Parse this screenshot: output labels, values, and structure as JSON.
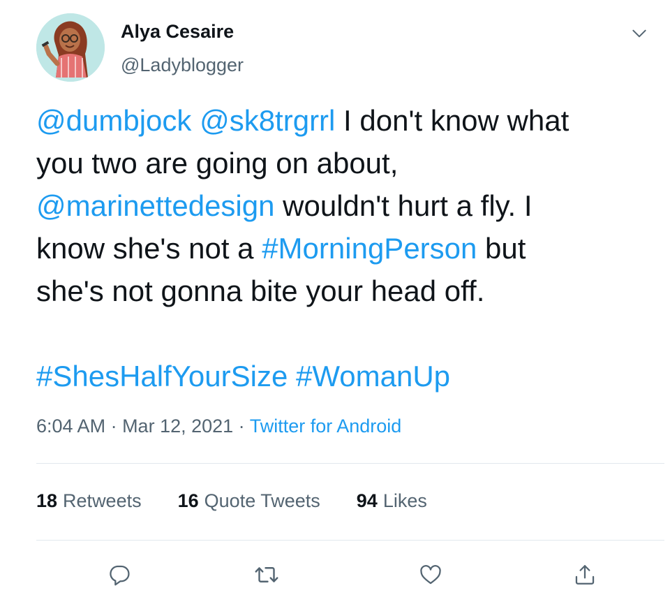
{
  "author": {
    "name": "Alya Cesaire",
    "handle": "@Ladyblogger"
  },
  "tweet": {
    "lines": [
      [
        {
          "text": "@dumbjock",
          "link": true
        },
        {
          "text": " ",
          "link": false
        },
        {
          "text": "@sk8trgrrl",
          "link": true
        },
        {
          "text": " I don't know what",
          "link": false
        }
      ],
      [
        {
          "text": "you two are going on about,",
          "link": false
        }
      ],
      [
        {
          "text": "@marinettedesign",
          "link": true
        },
        {
          "text": " wouldn't hurt a fly. I",
          "link": false
        }
      ],
      [
        {
          "text": "know she's not a ",
          "link": false
        },
        {
          "text": "#MorningPerson",
          "link": true
        },
        {
          "text": " but",
          "link": false
        }
      ],
      [
        {
          "text": "she's not gonna bite your head off.",
          "link": false
        }
      ],
      [],
      [
        {
          "text": "#ShesHalfYourSize",
          "link": true
        },
        {
          "text": " ",
          "link": false
        },
        {
          "text": "#WomanUp",
          "link": true
        }
      ]
    ]
  },
  "meta": {
    "time": "6:04 AM",
    "sep1": " · ",
    "date": "Mar 12, 2021",
    "sep2": " · ",
    "source": "Twitter for Android"
  },
  "stats": [
    {
      "count": "18",
      "label": "Retweets"
    },
    {
      "count": "16",
      "label": "Quote Tweets"
    },
    {
      "count": "94",
      "label": "Likes"
    }
  ],
  "icons": {
    "caret": "chevron-down-icon",
    "reply": "reply-icon",
    "retweet": "retweet-icon",
    "like": "heart-icon",
    "share": "share-icon"
  },
  "colors": {
    "link": "#1d9bf0",
    "text": "#0f1419",
    "secondary": "#536471",
    "divider": "#e1e8ed",
    "avatar_bg": "#bfe7e6"
  }
}
